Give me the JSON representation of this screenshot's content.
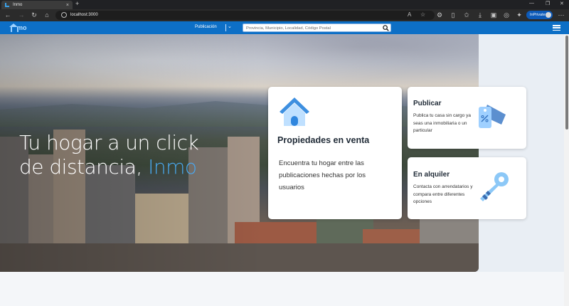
{
  "browser": {
    "tab_title": "Inmo",
    "tab_close": "×",
    "new_tab": "+",
    "url": "localhost:3000",
    "inprivate_label": "InPrivate",
    "controls": {
      "minimize": "—",
      "maximize": "❐",
      "close": "✕"
    }
  },
  "nav": {
    "logo_text": "mo",
    "publicacion_label": "Publicación",
    "dropdown_icon": "⌄",
    "search": {
      "placeholder": "Provincia, Municipio, Localidad, Código Postal",
      "value": ""
    }
  },
  "hero": {
    "title_line1": "Tu hogar a un click",
    "title_line2": "de distancia, ",
    "title_accent": "Inmo"
  },
  "cards": {
    "main": {
      "title": "Propiedades en venta",
      "description": "Encuentra tu hogar entre las publicaciones hechas por los usuarios",
      "icon": "house-icon"
    },
    "publicar": {
      "title": "Publicar",
      "description": "Publica tu casa sin cargo ya seas una inmobiliaria o un particular",
      "icon": "price-tag-icon"
    },
    "alquiler": {
      "title": "En alquiler",
      "description": "Contacta con arrendatarios y compara entre diferentes opciones",
      "icon": "key-icon"
    }
  },
  "colors": {
    "nav_blue": "#0d6fc6",
    "accent": "#4aa8ef",
    "inprivate_blue": "#0d5ab8"
  }
}
